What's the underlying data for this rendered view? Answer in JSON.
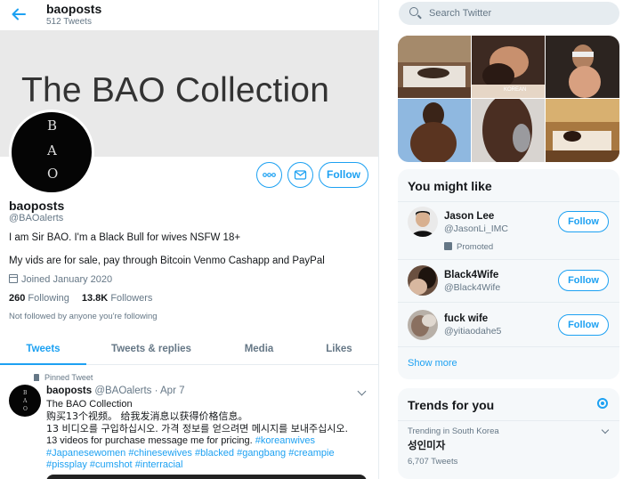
{
  "header": {
    "name": "baoposts",
    "tweet_count": "512 Tweets"
  },
  "banner": {
    "text": "The BAO Collection"
  },
  "avatar": {
    "letters": [
      "B",
      "A",
      "O"
    ]
  },
  "profile": {
    "follow_label": "Follow",
    "name": "baoposts",
    "handle": "@BAOalerts",
    "bio_line1": "I am Sir BAO. I'm a Black Bull for wives  NSFW 18+",
    "bio_line2": "My vids are for sale, pay through Bitcoin Venmo Cashapp and PayPal",
    "joined": "Joined January 2020",
    "following_count": "260",
    "following_label": "Following",
    "followers_count": "13.8K",
    "followers_label": "Followers",
    "not_followed": "Not followed by anyone you're following"
  },
  "tabs": [
    "Tweets",
    "Tweets & replies",
    "Media",
    "Likes"
  ],
  "tweet": {
    "pinned_label": "Pinned Tweet",
    "name": "baoposts",
    "handle": "@BAOalerts",
    "date": "· Apr 7",
    "line1": "The BAO Collection",
    "line2": "购买13个视频。 给我发消息以获得价格信息。",
    "line3": "13 비디오를 구입하십시오. 가격 정보를 얻으려면 메시지를 보내주십시오.",
    "line4_text": "13 videos for purchase message me for pricing. ",
    "hashtags": [
      "#koreanwives",
      "#Japanesewomen",
      "#chinesewives",
      "#blacked",
      "#gangbang",
      "#creampie",
      "#pissplay",
      "#cumshot",
      "#interracial"
    ]
  },
  "search": {
    "placeholder": "Search Twitter"
  },
  "media_grid": {
    "overlay_text": "KOREAN"
  },
  "you_might_like": {
    "title": "You might like",
    "items": [
      {
        "name": "Jason Lee",
        "handle": "@JasonLi_IMC",
        "promoted": "Promoted",
        "follow_label": "Follow"
      },
      {
        "name": "Black4Wife",
        "handle": "@Black4Wife",
        "follow_label": "Follow"
      },
      {
        "name": "fuck wife",
        "handle": "@yitiaodahe5",
        "follow_label": "Follow"
      }
    ],
    "show_more": "Show more"
  },
  "trends": {
    "title": "Trends for you",
    "items": [
      {
        "context": "Trending in South Korea",
        "name": "성인미자",
        "count": "6,707 Tweets"
      }
    ]
  },
  "colors": {
    "accent": "#1da1f2",
    "secondary_text": "#657786",
    "divider": "#e6ecf0",
    "sidebar_card": "#f5f8fa"
  }
}
